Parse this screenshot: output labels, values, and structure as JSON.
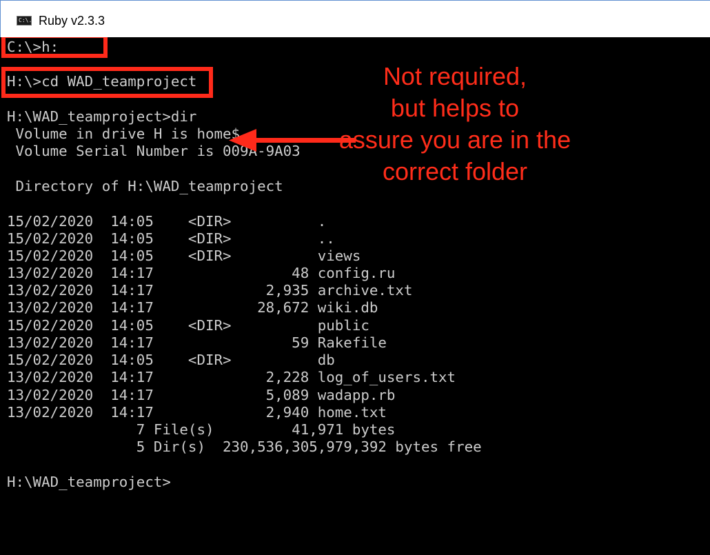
{
  "window": {
    "title": "Ruby v2.3.3",
    "icon": "console-icon",
    "icon_text": "C:\\."
  },
  "console": {
    "lines": [
      "C:\\>h:",
      "",
      "H:\\>cd WAD_teamproject",
      "",
      "H:\\WAD_teamproject>dir",
      " Volume in drive H is home$",
      " Volume Serial Number is 009A-9A03",
      "",
      " Directory of H:\\WAD_teamproject",
      "",
      "15/02/2020  14:05    <DIR>          .",
      "15/02/2020  14:05    <DIR>          ..",
      "15/02/2020  14:05    <DIR>          views",
      "13/02/2020  14:17                48 config.ru",
      "13/02/2020  14:17             2,935 archive.txt",
      "13/02/2020  14:17            28,672 wiki.db",
      "15/02/2020  14:05    <DIR>          public",
      "13/02/2020  14:17                59 Rakefile",
      "15/02/2020  14:05    <DIR>          db",
      "13/02/2020  14:17             2,228 log_of_users.txt",
      "13/02/2020  14:17             5,089 wadapp.rb",
      "13/02/2020  14:17             2,940 home.txt",
      "               7 File(s)         41,971 bytes",
      "               5 Dir(s)  230,536,305,979,392 bytes free",
      "",
      "H:\\WAD_teamproject>"
    ]
  },
  "annotation": {
    "lines": [
      "Not required,",
      "but helps to",
      "assure you are in the",
      "correct folder"
    ],
    "color": "#ff2d1a"
  },
  "colors": {
    "console_bg": "#000000",
    "console_text": "#cccccc",
    "highlight": "#ff2a1a",
    "title_border": "#5f8fd0"
  }
}
